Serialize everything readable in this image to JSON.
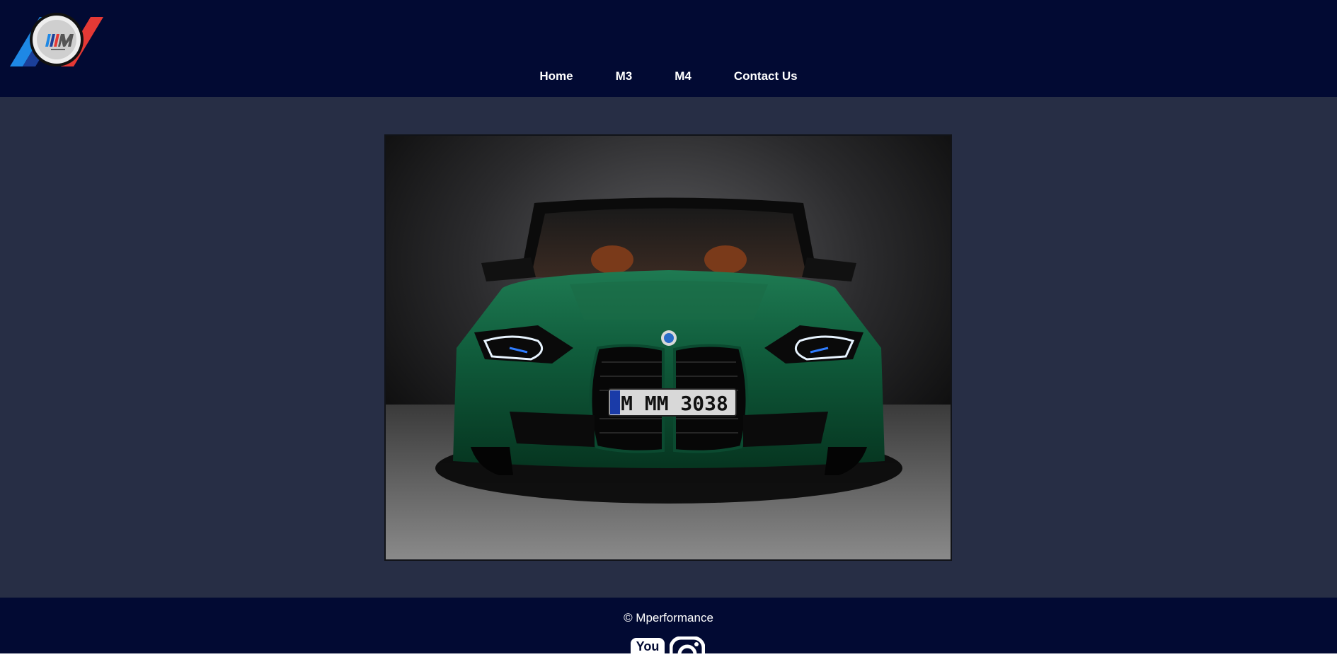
{
  "brand": {
    "logo_icon": "m-performance-logo",
    "colors": {
      "header_bg": "#020a33",
      "main_bg": "#272e45",
      "stripe_light_blue": "#1e88e5",
      "stripe_dark_blue": "#1b3f99",
      "stripe_red": "#e53935"
    }
  },
  "nav": {
    "items": [
      {
        "label": "Home"
      },
      {
        "label": "M3"
      },
      {
        "label": "M4"
      },
      {
        "label": "Contact Us"
      }
    ]
  },
  "hero": {
    "image_subject": "green-bmw-m3-front-view",
    "car_color": "#0f5a3a",
    "plate_text": "M MM 3038"
  },
  "footer": {
    "copyright": "© Mperformance",
    "social": [
      {
        "icon": "youtube-icon",
        "label": "You"
      },
      {
        "icon": "instagram-icon"
      }
    ]
  }
}
